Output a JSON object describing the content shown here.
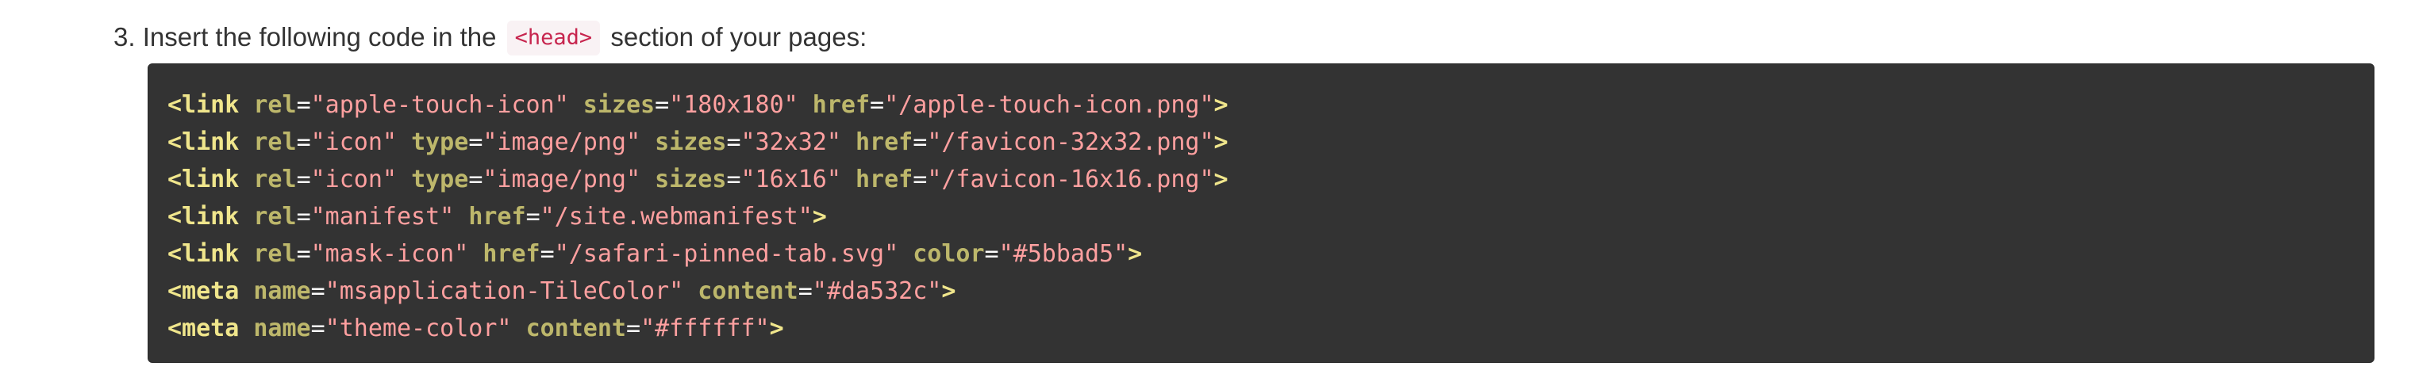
{
  "step": {
    "number": "3.",
    "text_before": "Insert the following code in the",
    "code_tag": "<head>",
    "text_after": "section of your pages:"
  },
  "code_lines": [
    {
      "tag": "<link",
      "attrs": [
        {
          "name": "rel",
          "value": "\"apple-touch-icon\""
        },
        {
          "name": "sizes",
          "value": "\"180x180\""
        },
        {
          "name": "href",
          "value": "\"/apple-touch-icon.png\""
        }
      ],
      "close": ">"
    },
    {
      "tag": "<link",
      "attrs": [
        {
          "name": "rel",
          "value": "\"icon\""
        },
        {
          "name": "type",
          "value": "\"image/png\""
        },
        {
          "name": "sizes",
          "value": "\"32x32\""
        },
        {
          "name": "href",
          "value": "\"/favicon-32x32.png\""
        }
      ],
      "close": ">"
    },
    {
      "tag": "<link",
      "attrs": [
        {
          "name": "rel",
          "value": "\"icon\""
        },
        {
          "name": "type",
          "value": "\"image/png\""
        },
        {
          "name": "sizes",
          "value": "\"16x16\""
        },
        {
          "name": "href",
          "value": "\"/favicon-16x16.png\""
        }
      ],
      "close": ">"
    },
    {
      "tag": "<link",
      "attrs": [
        {
          "name": "rel",
          "value": "\"manifest\""
        },
        {
          "name": "href",
          "value": "\"/site.webmanifest\""
        }
      ],
      "close": ">"
    },
    {
      "tag": "<link",
      "attrs": [
        {
          "name": "rel",
          "value": "\"mask-icon\""
        },
        {
          "name": "href",
          "value": "\"/safari-pinned-tab.svg\""
        },
        {
          "name": "color",
          "value": "\"#5bbad5\""
        }
      ],
      "close": ">"
    },
    {
      "tag": "<meta",
      "attrs": [
        {
          "name": "name",
          "value": "\"msapplication-TileColor\""
        },
        {
          "name": "content",
          "value": "\"#da532c\""
        }
      ],
      "close": ">"
    },
    {
      "tag": "<meta",
      "attrs": [
        {
          "name": "name",
          "value": "\"theme-color\""
        },
        {
          "name": "content",
          "value": "\"#ffffff\""
        }
      ],
      "close": ">"
    }
  ],
  "colors": {
    "code_background": "#333333",
    "tag": "#f0e68c",
    "attribute": "#bdb76b",
    "string": "#ffa0a0",
    "inline_code_text": "#c7254e",
    "inline_code_background": "#f9f2f4",
    "body_text": "#333333"
  }
}
